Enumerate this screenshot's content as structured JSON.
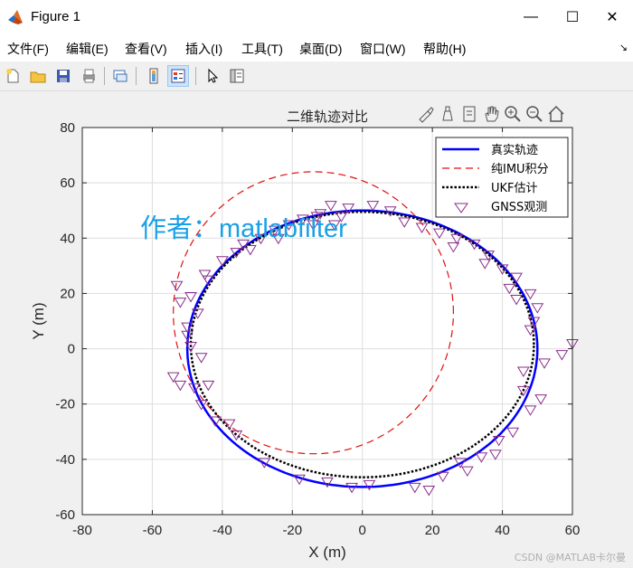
{
  "window": {
    "title": "Figure 1",
    "minimize": "—",
    "maximize": "☐",
    "close": "✕"
  },
  "menu": [
    "文件(F)",
    "编辑(E)",
    "查看(V)",
    "插入(I)",
    "工具(T)",
    "桌面(D)",
    "窗口(W)",
    "帮助(H)"
  ],
  "menu_arrow": "↘",
  "toolbar": [
    "new-figure-icon",
    "open-folder-icon",
    "save-icon",
    "print-icon",
    "link-icon",
    "colorbar-icon",
    "legend-icon",
    "pointer-icon",
    "property-inspector-icon"
  ],
  "axes_toolbar": [
    "brush-icon",
    "datatip-icon",
    "restore-icon",
    "pan-icon",
    "zoom-in-icon",
    "zoom-out-icon",
    "home-icon"
  ],
  "overlay_text": "作者：matlabfilter",
  "watermark": "CSDN @MATLAB卡尔曼",
  "colors": {
    "truth": "#0000ff",
    "imu": "#e01010",
    "ukf": "#000000",
    "gnss": "#8a2e8a",
    "overlay": "#1aa0e6"
  },
  "chart_data": {
    "type": "line",
    "title": "二维轨迹对比",
    "xlabel": "X (m)",
    "ylabel": "Y (m)",
    "xlim": [
      -80,
      60
    ],
    "ylim": [
      -60,
      80
    ],
    "xticks": [
      -80,
      -60,
      -40,
      -20,
      0,
      20,
      40,
      60
    ],
    "yticks": [
      -60,
      -40,
      -20,
      0,
      20,
      40,
      60,
      80
    ],
    "grid": true,
    "legend_position": "top-right",
    "series": [
      {
        "name": "真实轨迹",
        "style": "solid",
        "shape": "ellipse",
        "center": [
          0,
          0
        ],
        "radius": [
          50,
          50
        ]
      },
      {
        "name": "纯IMU积分",
        "style": "dashed",
        "shape": "ellipse",
        "center": [
          -14,
          13
        ],
        "radius": [
          40,
          51
        ]
      },
      {
        "name": "UKF估计",
        "style": "dotted",
        "shape": "ellipse",
        "center": [
          0,
          1.5
        ],
        "radius": [
          49,
          48
        ]
      },
      {
        "name": "GNSS观测",
        "style": "marker-triangle-down",
        "points": [
          [
            -9,
            52
          ],
          [
            3,
            52
          ],
          [
            -4,
            51
          ],
          [
            -12,
            49
          ],
          [
            8,
            50
          ],
          [
            12,
            46
          ],
          [
            17,
            44
          ],
          [
            22,
            42
          ],
          [
            27,
            40
          ],
          [
            32,
            38
          ],
          [
            36,
            34
          ],
          [
            40,
            29
          ],
          [
            44,
            26
          ],
          [
            48,
            20
          ],
          [
            50,
            15
          ],
          [
            48,
            7
          ],
          [
            52,
            -5
          ],
          [
            57,
            -2
          ],
          [
            60,
            2
          ],
          [
            46,
            -15
          ],
          [
            48,
            -22
          ],
          [
            43,
            -30
          ],
          [
            39,
            -33
          ],
          [
            38,
            -38
          ],
          [
            34,
            -39
          ],
          [
            30,
            -44
          ],
          [
            23,
            -46
          ],
          [
            19,
            -51
          ],
          [
            15,
            -50
          ],
          [
            2,
            -49
          ],
          [
            -3,
            -50
          ],
          [
            -10,
            -48
          ],
          [
            -18,
            -47
          ],
          [
            -28,
            -41
          ],
          [
            -36,
            -31
          ],
          [
            -42,
            -26
          ],
          [
            -46,
            -20
          ],
          [
            -48,
            -14
          ],
          [
            -52,
            -13
          ],
          [
            -54,
            -10
          ],
          [
            -46,
            -3
          ],
          [
            -49,
            1
          ],
          [
            -50,
            5
          ],
          [
            -50,
            8
          ],
          [
            -47,
            13
          ],
          [
            -52,
            17
          ],
          [
            -49,
            19
          ],
          [
            -53,
            23
          ],
          [
            -45,
            27
          ],
          [
            -44,
            25
          ],
          [
            -40,
            32
          ],
          [
            -36,
            35
          ],
          [
            -34,
            38
          ],
          [
            -29,
            40
          ],
          [
            -25,
            43
          ],
          [
            -21,
            45
          ],
          [
            -17,
            47
          ],
          [
            -13,
            48
          ],
          [
            -8,
            45
          ],
          [
            -6,
            48
          ],
          [
            -14,
            45
          ],
          [
            -24,
            40
          ],
          [
            -32,
            36
          ],
          [
            26,
            37
          ],
          [
            35,
            31
          ],
          [
            42,
            22
          ],
          [
            44,
            18
          ],
          [
            49,
            10
          ],
          [
            46,
            -8
          ],
          [
            51,
            -18
          ],
          [
            28,
            -41
          ],
          [
            -38,
            -27
          ],
          [
            -44,
            -13
          ]
        ]
      }
    ]
  }
}
